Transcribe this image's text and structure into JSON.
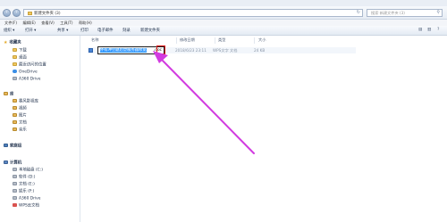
{
  "address": {
    "path": "新建文件夹 (3)"
  },
  "search": {
    "placeholder": "搜索 新建文件夹 (3)"
  },
  "menu": [
    "文件(F)",
    "编辑(E)",
    "查看(V)",
    "工具(T)",
    "帮助(H)"
  ],
  "toolbar": {
    "organize": "组织 ▾",
    "open": "打开 ▾",
    "share": "共享 ▾",
    "print": "打印",
    "email": "电子邮件",
    "burn": "刻录",
    "new_folder": "新建文件夹"
  },
  "sidebar": {
    "favorites": "收藏夹",
    "downloads": "下载",
    "desktop": "桌面",
    "recent": "最近访问的位置",
    "onedrive": "OneDrive",
    "a360": "A360 Drive",
    "libraries": "库",
    "videos": "暴风影视库",
    "pictures": "视频",
    "images": "图片",
    "docs": "文档",
    "music": "音乐",
    "homegroup": "家庭组",
    "computer": "计算机",
    "local_c": "本地磁盘 (C:)",
    "soft_d": "软件 (D:)",
    "doc_e": "文档 (E:)",
    "ent_f": "娱乐 (F:)",
    "a360_2": "A360 Drive",
    "wps": "WPS云文档"
  },
  "columns": {
    "name": "名称",
    "modified": "修改日期",
    "type": "类型",
    "size": "大小"
  },
  "file": {
    "name_selected": "怀有冲空题后塑服务器修宽",
    "ext": ".doc",
    "modified": "2018/6/23 23:11",
    "type": "WPS文字 文档",
    "size": "24 KB"
  },
  "colors": {
    "accent": "#3399ff",
    "arrow": "#d23be0",
    "highlight_box": "#e01818"
  }
}
